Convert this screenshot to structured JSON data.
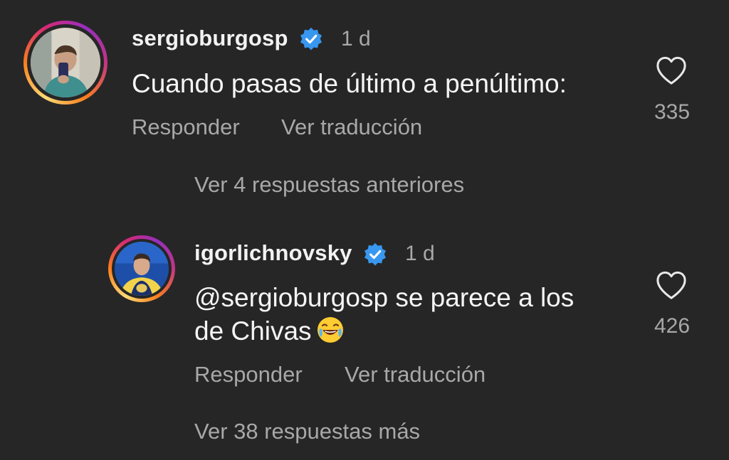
{
  "comments": [
    {
      "username": "sergioburgosp",
      "verified": true,
      "time": "1 d",
      "text": "Cuando pasas de último a penúltimo:",
      "reply_label": "Responder",
      "translate_label": "Ver traducción",
      "likes": "335",
      "avatar": "profile-photo"
    },
    {
      "username": "igorlichnovsky",
      "verified": true,
      "time": "1 d",
      "text_mention": "@sergioburgosp",
      "text_line1_rest": " se parece a los",
      "text_line2": "de Chivas",
      "emoji": "face-with-tears-of-joy",
      "reply_label": "Responder",
      "translate_label": "Ver traducción",
      "likes": "426",
      "avatar": "profile-photo"
    }
  ],
  "view_previous_replies": "Ver 4 respuestas anteriores",
  "view_more_replies": "Ver 38 respuestas más",
  "colors": {
    "background": "#262626",
    "verified": "#3897f0",
    "secondary_text": "#a8a8a8"
  }
}
